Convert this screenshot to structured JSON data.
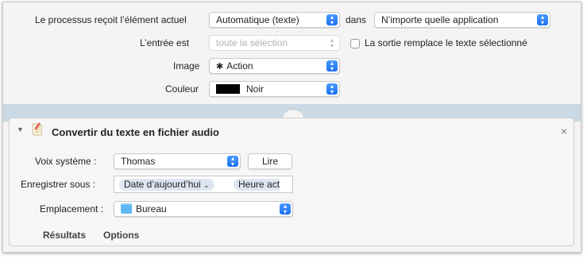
{
  "workflow": {
    "receives_label": "Le processus reçoit l’élément actuel",
    "receives_value": "Automatique (texte)",
    "in_label": "dans",
    "in_value": "N’importe quelle application",
    "input_label": "L’entrée est",
    "input_value": "toute la sélection",
    "replace_label": "La sortie remplace le texte sélectionné",
    "image_label": "Image",
    "image_value": "Action",
    "color_label": "Couleur",
    "color_value": "Noir",
    "color_swatch": "#000000"
  },
  "action": {
    "title": "Convertir du texte en fichier audio",
    "close_glyph": "×",
    "voice_label": "Voix système :",
    "voice_value": "Thomas",
    "play_label": "Lire",
    "save_as_label": "Enregistrer sous :",
    "token_date": "Date d’aujourd’hui",
    "token_time": "Heure act",
    "location_label": "Emplacement :",
    "location_value": "Bureau",
    "tabs": [
      "Résultats",
      "Options"
    ]
  },
  "colors": {
    "accent": "#1a6ff0",
    "band": "#c9d9e6"
  },
  "icons": {
    "gear": "gear-icon",
    "script": "script-icon",
    "folder": "folder-icon",
    "disclosure": "disclosure-triangle-icon"
  }
}
